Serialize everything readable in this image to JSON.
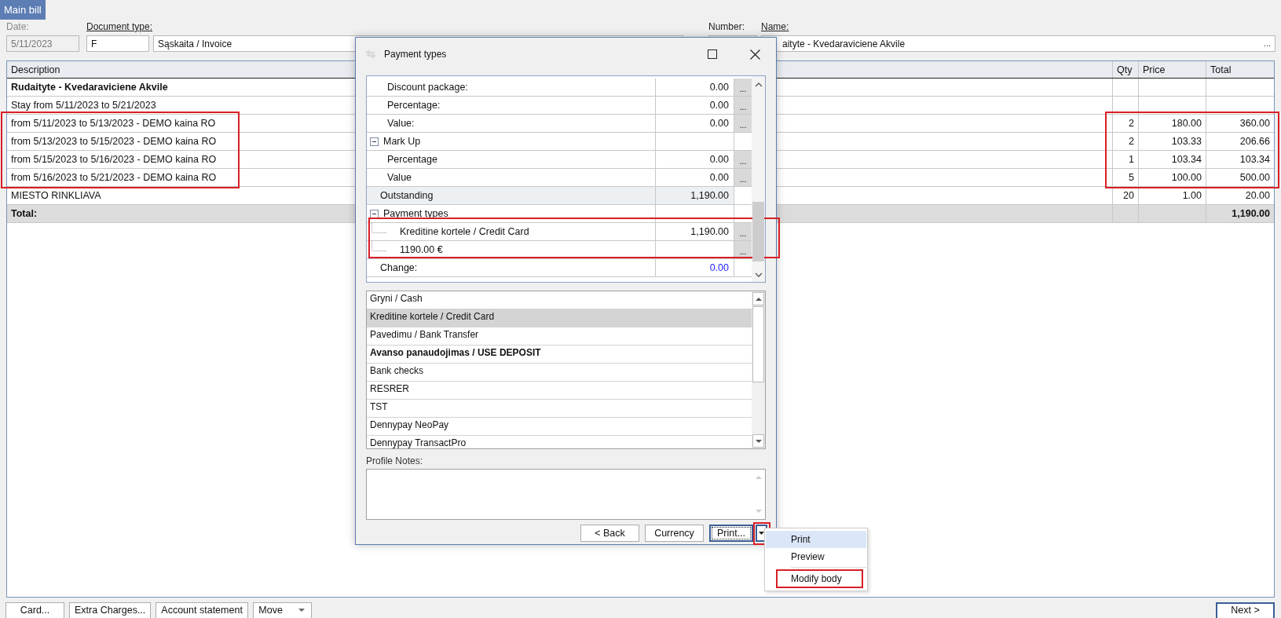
{
  "tab": {
    "label": "Main bill",
    "selected": true
  },
  "header": {
    "date_label": "Date:",
    "date_value": "5/11/2023",
    "doctype_label": "Document type:",
    "doctype_code": "F",
    "doctype_name": "Sąskaita / Invoice",
    "number_label": "Number:",
    "name_label": "Name:",
    "name_value": "aityte - Kvedaraviciene Akvile",
    "name_button": "..."
  },
  "table": {
    "columns": [
      "Description",
      "Qty",
      "Price",
      "Total"
    ],
    "rows": [
      {
        "kind": "guest",
        "description": "Rudaityte - Kvedaraviciene Akvile",
        "marked": false
      },
      {
        "kind": "line",
        "description": "Stay from 5/11/2023 to 5/21/2023",
        "marked": false
      },
      {
        "kind": "line",
        "description": "from 5/11/2023 to 5/13/2023 - DEMO kaina RO",
        "qty": "2",
        "price": "180.00",
        "total": "360.00",
        "marked": true
      },
      {
        "kind": "line",
        "description": "from 5/13/2023 to 5/15/2023 - DEMO kaina RO",
        "qty": "2",
        "price": "103.33",
        "total": "206.66",
        "marked": true
      },
      {
        "kind": "line",
        "description": "from 5/15/2023 to 5/16/2023 - DEMO kaina RO",
        "qty": "1",
        "price": "103.34",
        "total": "103.34",
        "marked": true
      },
      {
        "kind": "line",
        "description": "from 5/16/2023 to 5/21/2023 - DEMO kaina RO",
        "qty": "5",
        "price": "100.00",
        "total": "500.00",
        "marked": true
      },
      {
        "kind": "line",
        "description": "MIESTO RINKLIAVA",
        "qty": "20",
        "price": "1.00",
        "total": "20.00",
        "marked": false
      },
      {
        "kind": "total",
        "description": "Total:",
        "total": "1,190.00",
        "marked": false
      }
    ]
  },
  "dialog": {
    "title": "Payment types",
    "grid": {
      "rows": [
        {
          "kind": "item",
          "label": "Discount package:",
          "value": "0.00",
          "button": "...",
          "marked": false
        },
        {
          "kind": "item",
          "label": "Percentage:",
          "value": "0.00",
          "button": "...",
          "marked": false
        },
        {
          "kind": "item",
          "label": "Value:",
          "value": "0.00",
          "button": "...",
          "marked": false
        },
        {
          "kind": "category",
          "label": "Mark Up",
          "expanded": true,
          "marked": false
        },
        {
          "kind": "item",
          "label": "Percentage",
          "value": "0.00",
          "button": "...",
          "marked": false
        },
        {
          "kind": "item",
          "label": "Value",
          "value": "0.00",
          "button": "...",
          "marked": false
        },
        {
          "kind": "summary",
          "label": "Outstanding",
          "value": "1,190.00",
          "marked": false
        },
        {
          "kind": "category",
          "label": "Payment types",
          "expanded": true,
          "marked": false
        },
        {
          "kind": "payment",
          "label": "Kreditine kortele / Credit Card",
          "value": "1,190.00",
          "button": "...",
          "marked": true
        },
        {
          "kind": "payment",
          "label": "1190.00 €",
          "button": "...",
          "marked": true
        },
        {
          "kind": "result",
          "label": "Change:",
          "value": "0.00",
          "marked": false
        }
      ]
    },
    "list": {
      "items": [
        {
          "label": "Gryni / Cash",
          "selected": false,
          "bold": false
        },
        {
          "label": "Kreditine kortele / Credit Card",
          "selected": true,
          "bold": false
        },
        {
          "label": "Pavedimu / Bank Transfer",
          "selected": false,
          "bold": false
        },
        {
          "label": "Avanso panaudojimas / USE DEPOSIT",
          "selected": false,
          "bold": true
        },
        {
          "label": "Bank checks",
          "selected": false,
          "bold": false
        },
        {
          "label": "RESRER",
          "selected": false,
          "bold": false
        },
        {
          "label": "TST",
          "selected": false,
          "bold": false
        },
        {
          "label": "Dennypay NeoPay",
          "selected": false,
          "bold": false
        },
        {
          "label": "Dennypay TransactPro",
          "selected": false,
          "bold": false
        }
      ]
    },
    "notes_label": "Profile Notes:",
    "buttons": [
      "< Back",
      "Currency"
    ],
    "print_button": {
      "label": "Print...",
      "dropdown_marked": true
    },
    "menu": {
      "items": [
        {
          "label": "Print",
          "selected": true,
          "marked": false
        },
        {
          "label": "Preview",
          "selected": false,
          "marked": false
        },
        {
          "label": "Modify body",
          "selected": false,
          "marked": true
        }
      ]
    }
  },
  "bottom_buttons": [
    {
      "kind": "plain",
      "label": "Card..."
    },
    {
      "kind": "plain",
      "label": "Extra Charges..."
    },
    {
      "kind": "plain",
      "label": "Account statement"
    },
    {
      "kind": "dropdown",
      "label": "Move"
    }
  ],
  "next_button": "Next >"
}
